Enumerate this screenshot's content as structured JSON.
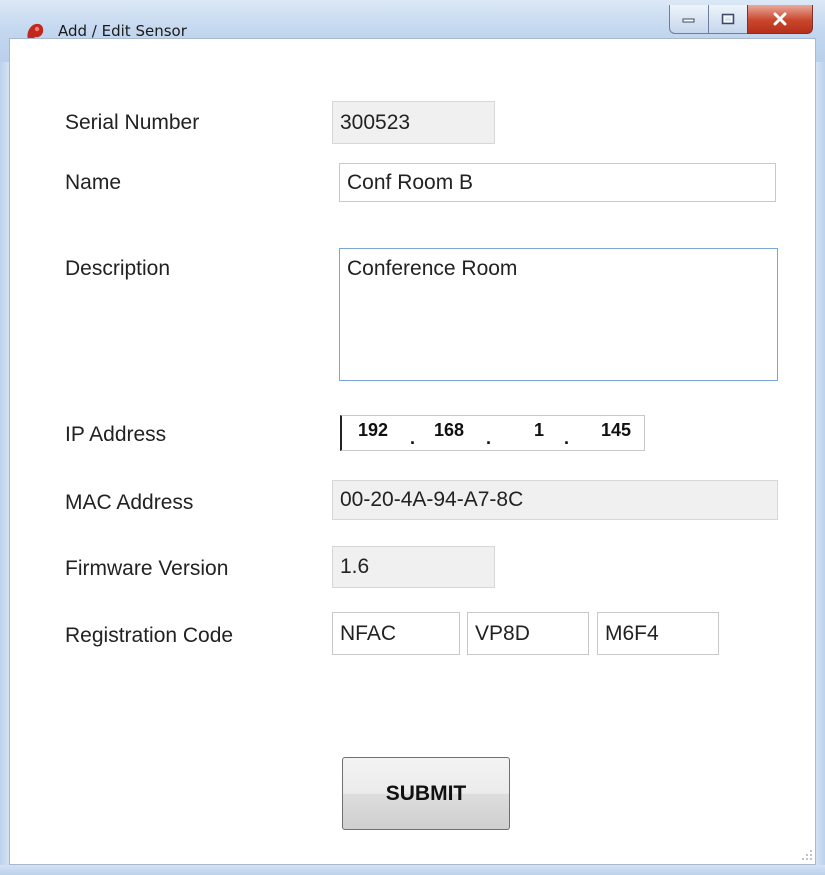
{
  "window": {
    "title": "Add / Edit Sensor",
    "controls": {
      "minimize": "minimize-icon",
      "maximize": "maximize-icon",
      "close": "close-icon"
    }
  },
  "form": {
    "serial_number": {
      "label": "Serial Number",
      "value": "300523"
    },
    "name": {
      "label": "Name",
      "value": "Conf Room B"
    },
    "description": {
      "label": "Description",
      "value": "Conference Room"
    },
    "ip_address": {
      "label": "IP Address",
      "octets": [
        "192",
        "168",
        "1",
        "145"
      ],
      "separator": "."
    },
    "mac_address": {
      "label": "MAC Address",
      "value": "00-20-4A-94-A7-8C"
    },
    "firmware_version": {
      "label": "Firmware Version",
      "value": "1.6"
    },
    "registration_code": {
      "label": "Registration Code",
      "parts": [
        "NFAC",
        "VP8D",
        "M6F4"
      ]
    }
  },
  "actions": {
    "submit_label": "SUBMIT"
  },
  "colors": {
    "titlebar": "#c3d7ef",
    "close_button": "#c9462c",
    "app_icon": "#c0281e"
  }
}
